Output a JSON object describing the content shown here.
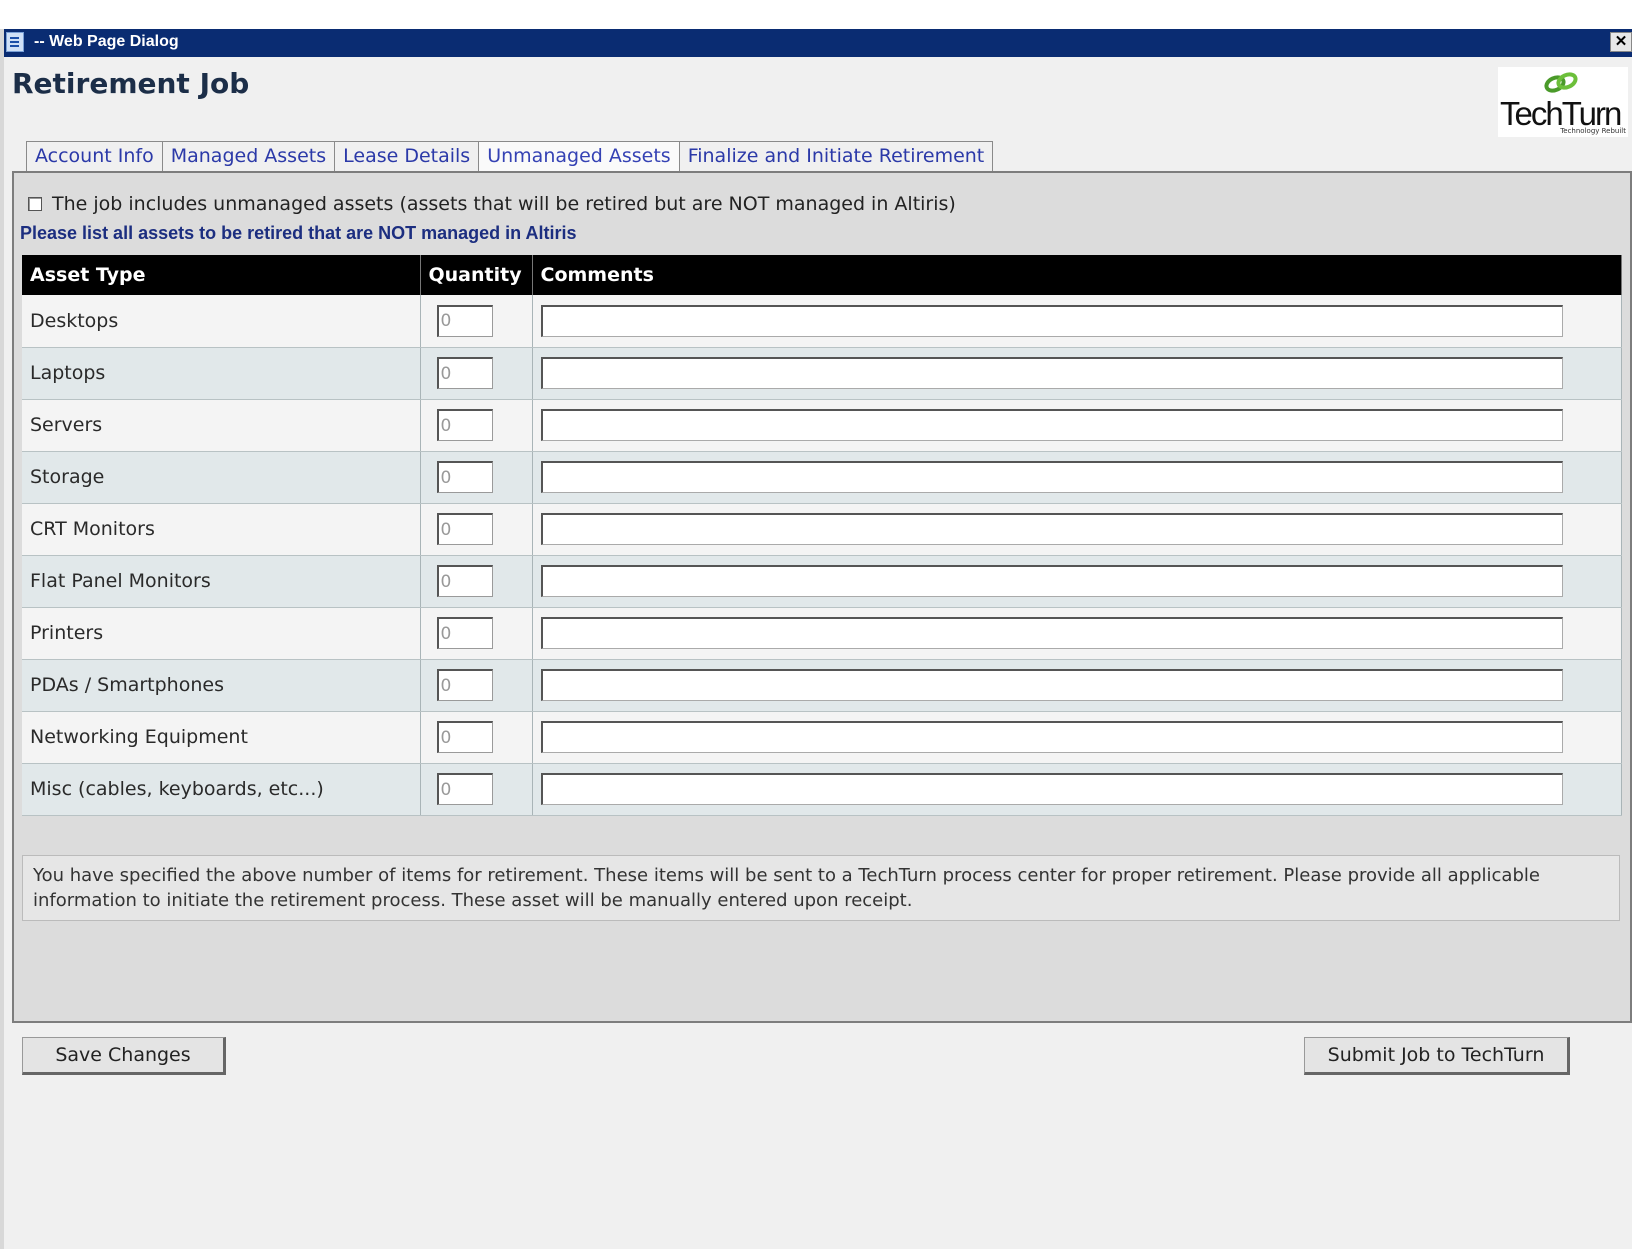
{
  "window": {
    "title": "-- Web Page Dialog",
    "close_glyph": "✕"
  },
  "page": {
    "title": "Retirement Job"
  },
  "logo": {
    "name": "TechTurn",
    "tagline": "Technology Rebuilt"
  },
  "tabs": [
    {
      "label": "Account Info",
      "active": false
    },
    {
      "label": "Managed Assets",
      "active": false
    },
    {
      "label": "Lease Details",
      "active": false
    },
    {
      "label": "Unmanaged Assets",
      "active": true
    },
    {
      "label": "Finalize and Initiate Retirement",
      "active": false
    }
  ],
  "form": {
    "include_checkbox_label": "The job includes unmanaged assets (assets that will be retired but are NOT managed in Altiris)",
    "include_checked": false,
    "instruction": "Please list all assets to be retired that are NOT managed in Altiris",
    "columns": [
      "Asset Type",
      "Quantity",
      "Comments"
    ],
    "rows": [
      {
        "type": "Desktops",
        "quantity": "0",
        "comments": ""
      },
      {
        "type": "Laptops",
        "quantity": "0",
        "comments": ""
      },
      {
        "type": "Servers",
        "quantity": "0",
        "comments": ""
      },
      {
        "type": "Storage",
        "quantity": "0",
        "comments": ""
      },
      {
        "type": "CRT Monitors",
        "quantity": "0",
        "comments": ""
      },
      {
        "type": "Flat Panel Monitors",
        "quantity": "0",
        "comments": ""
      },
      {
        "type": "Printers",
        "quantity": "0",
        "comments": ""
      },
      {
        "type": "PDAs / Smartphones",
        "quantity": "0",
        "comments": ""
      },
      {
        "type": "Networking Equipment",
        "quantity": "0",
        "comments": ""
      },
      {
        "type": "Misc (cables, keyboards, etc...)",
        "quantity": "0",
        "comments": ""
      }
    ],
    "note": "You have specified the above number of items for retirement. These items will be sent to a TechTurn process center for proper retirement. Please provide all applicable information to initiate the retirement process. These asset will be manually entered upon receipt."
  },
  "buttons": {
    "save_label": "Save Changes",
    "submit_label": "Submit Job to TechTurn"
  },
  "colors": {
    "titlebar": "#0a2c72",
    "tab_text": "#2b39a8",
    "table_header": "#000000",
    "row_alt": "#e1e8ea"
  }
}
